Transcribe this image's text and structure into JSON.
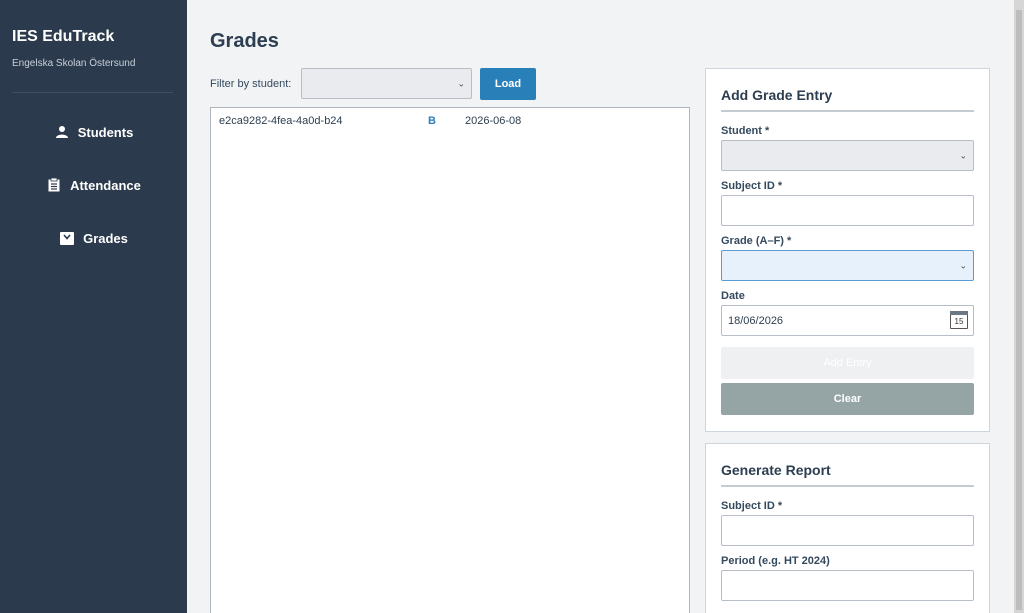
{
  "sidebar": {
    "app_title": "IES EduTrack",
    "school": "Engelska Skolan Östersund",
    "items": [
      {
        "label": "Students",
        "icon": "user-icon"
      },
      {
        "label": "Attendance",
        "icon": "clipboard-icon"
      },
      {
        "label": "Grades",
        "icon": "grades-icon"
      }
    ]
  },
  "main": {
    "title": "Grades",
    "filter": {
      "label": "Filter by student:",
      "selected": ""
    },
    "load_label": "Load",
    "grades": [
      {
        "id": "e2ca9282-4fea-4a0d-b24",
        "grade": "B",
        "date": "2026-06-08"
      }
    ]
  },
  "add_grade": {
    "title": "Add Grade Entry",
    "student_label": "Student *",
    "student_value": "",
    "subject_label": "Subject ID *",
    "subject_value": "",
    "grade_label": "Grade (A–F) *",
    "grade_value": "",
    "date_label": "Date",
    "date_value": "18/06/2026",
    "calendar_day": "15",
    "add_label": "Add Entry",
    "clear_label": "Clear"
  },
  "report": {
    "title": "Generate Report",
    "subject_label": "Subject ID *",
    "subject_value": "",
    "period_label": "Period (e.g. HT 2024)",
    "period_value": ""
  },
  "colors": {
    "sidebar_bg": "#2b3a4d",
    "primary": "#2980b9",
    "clear_button": "#95a5a6"
  }
}
